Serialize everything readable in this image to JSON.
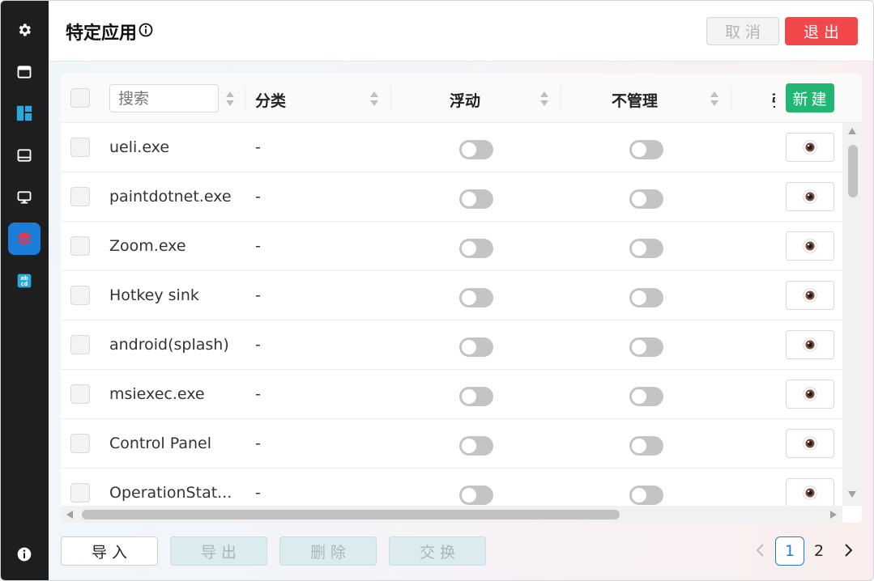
{
  "header": {
    "title": "特定应用",
    "cancel_label": "取消",
    "exit_label": "退出"
  },
  "sidebar": {
    "items": [
      {
        "icon": "gear-icon"
      },
      {
        "icon": "window-icon"
      },
      {
        "icon": "layout-icon"
      },
      {
        "icon": "taskbar-icon"
      },
      {
        "icon": "monitor-icon"
      },
      {
        "icon": "layers-icon",
        "active": true
      },
      {
        "icon": "abcd-icon"
      }
    ],
    "bottom_icon": "info-icon"
  },
  "table": {
    "search_placeholder": "搜索",
    "columns": {
      "category": "分类",
      "floating": "浮动",
      "unmanaged": "不管理",
      "truncated": "强"
    },
    "new_label": "新建",
    "rows": [
      {
        "name": "ueli.exe",
        "category": "-",
        "floating": false,
        "unmanaged": false
      },
      {
        "name": "paintdotnet.exe",
        "category": "-",
        "floating": false,
        "unmanaged": false
      },
      {
        "name": "Zoom.exe",
        "category": "-",
        "floating": false,
        "unmanaged": false
      },
      {
        "name": "Hotkey sink",
        "category": "-",
        "floating": false,
        "unmanaged": false
      },
      {
        "name": "android(splash)",
        "category": "-",
        "floating": false,
        "unmanaged": false
      },
      {
        "name": "msiexec.exe",
        "category": "-",
        "floating": false,
        "unmanaged": false
      },
      {
        "name": "Control Panel",
        "category": "-",
        "floating": false,
        "unmanaged": false
      },
      {
        "name": "OperationStat...",
        "category": "-",
        "floating": false,
        "unmanaged": false
      }
    ],
    "row_action_icon": "eye-icon"
  },
  "footer": {
    "import_label": "导入",
    "export_label": "导出",
    "delete_label": "删除",
    "swap_label": "交换"
  },
  "pagination": {
    "current": "1",
    "next_page": "2"
  },
  "colors": {
    "accent": "#1a7ed8",
    "exit": "#f2484c",
    "new": "#22b573"
  }
}
